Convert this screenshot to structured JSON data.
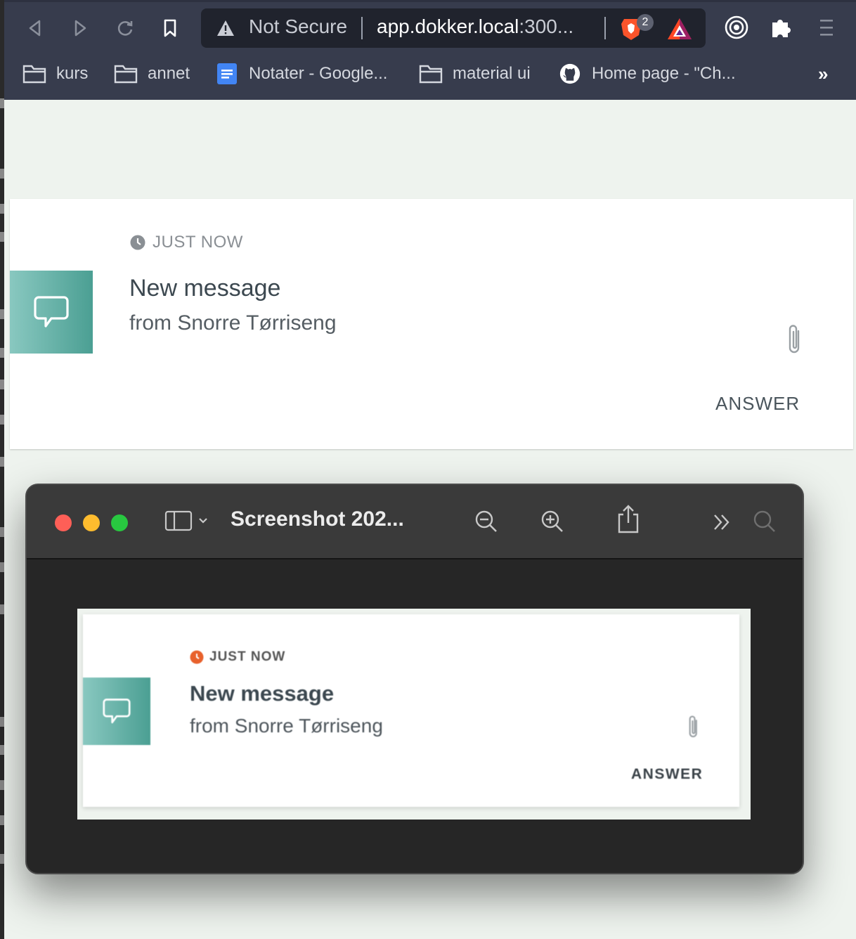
{
  "browser": {
    "url_warning": "Not Secure",
    "url_host": "app.dokker.local",
    "url_rest": ":300...",
    "shields_count": "2",
    "bookmarks": [
      {
        "label": "kurs",
        "icon": "folder-icon"
      },
      {
        "label": "annet",
        "icon": "folder-icon"
      },
      {
        "label": "Notater - Google...",
        "icon": "google-docs-icon"
      },
      {
        "label": "material ui",
        "icon": "folder-icon"
      },
      {
        "label": "Home page - \"Ch...",
        "icon": "github-icon"
      }
    ],
    "bookmarks_overflow": "»"
  },
  "notification": {
    "time": "JUST NOW",
    "title": "New message",
    "subtitle": "from Snorre Tørriseng",
    "action": "ANSWER"
  },
  "preview": {
    "title": "Screenshot 202...",
    "notification": {
      "time": "JUST NOW",
      "title": "New message",
      "subtitle": "from Snorre Tørriseng",
      "action": "ANSWER"
    }
  },
  "colors": {
    "chrome_bg": "#373c4d",
    "page_bg": "#eef3ee",
    "teal": "#4b9f93",
    "clock_orange": "#e8612c"
  }
}
